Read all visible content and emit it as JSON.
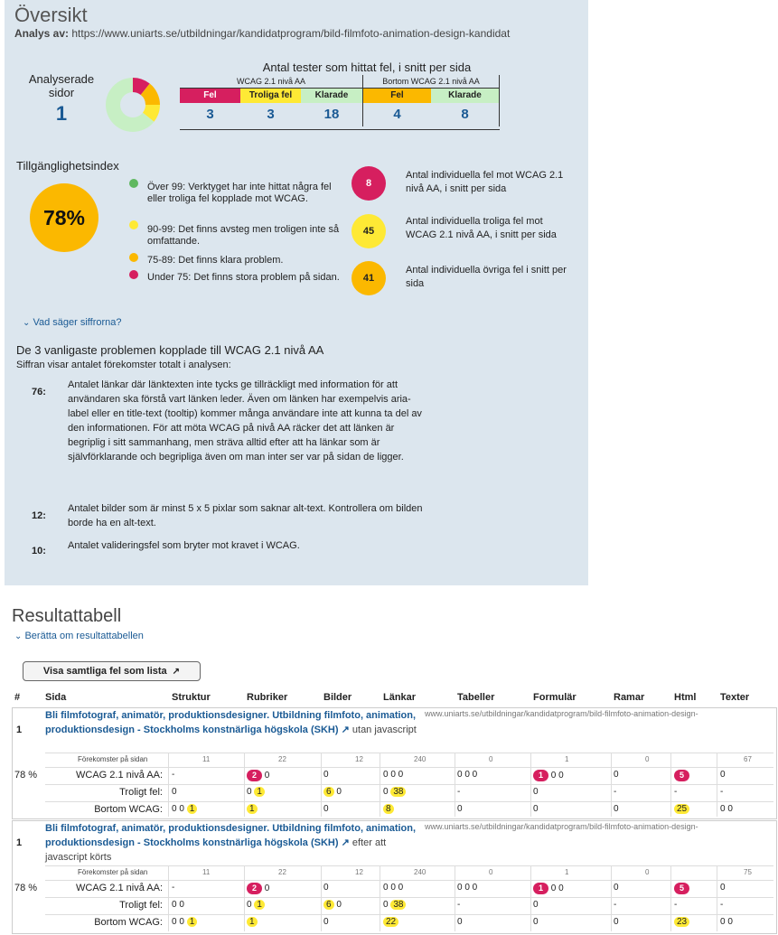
{
  "overview": {
    "title": "Översikt",
    "analys_label": "Analys av:",
    "analys_url": "https://www.uniarts.se/utbildningar/kandidatprogram/bild-filmfoto-animation-design-kandidat",
    "pages_label": "Analyserade sidor",
    "pages_count": "1",
    "tests_title": "Antal tester som hittat fel, i snitt per sida",
    "wcag_group": "WCAG 2.1 nivå AA",
    "beyond_group": "Bortom WCAG 2.1 nivå AA",
    "tests": [
      {
        "label": "Fel",
        "value": "3",
        "color": "#d61f5f",
        "fg": "#fff"
      },
      {
        "label": "Troliga fel",
        "value": "3",
        "color": "#fee935",
        "fg": "#111"
      },
      {
        "label": "Klarade",
        "value": "18",
        "color": "#c7efc4",
        "fg": "#111"
      },
      {
        "label": "Fel",
        "value": "4",
        "color": "#fbb800",
        "fg": "#111"
      },
      {
        "label": "Klarade",
        "value": "8",
        "color": "#c7efc4",
        "fg": "#111"
      }
    ],
    "donut": {
      "passed": 18,
      "error": 3,
      "likely": 3,
      "beyond": 4
    }
  },
  "index": {
    "label": "Tillgänglighetsindex",
    "value": "78%",
    "legend": [
      {
        "text": "Över 99: Verktyget har inte hittat några fel eller troliga fel kopplade mot WCAG.",
        "color": "#5fb85f"
      },
      {
        "text": "90-99: Det finns avsteg men troligen inte så omfattande.",
        "color": "#fee935"
      },
      {
        "text": "75-89: Det finns klara problem.",
        "color": "#fbb800"
      },
      {
        "text": "Under 75: Det finns stora problem på sidan.",
        "color": "#d61f5f"
      }
    ],
    "individual": [
      {
        "value": "8",
        "text": "Antal individuella fel mot WCAG 2.1 nivå AA, i snitt per sida",
        "color": "#d61f5f",
        "fg": "#fff"
      },
      {
        "value": "45",
        "text": "Antal individuella troliga fel mot WCAG 2.1 nivå AA, i snitt per sida",
        "color": "#fee935",
        "fg": "#111"
      },
      {
        "value": "41",
        "text": "Antal individuella övriga fel i snitt per sida",
        "color": "#fbb800",
        "fg": "#111"
      }
    ],
    "explain_link": "Vad säger siffrorna?"
  },
  "common": {
    "title": "De 3 vanligaste problemen kopplade till WCAG 2.1 nivå AA",
    "subtitle": "Siffran visar antalet förekomster totalt i analysen:",
    "items": [
      {
        "count": "76:",
        "text": "Antalet länkar där länktexten inte tycks ge tillräckligt med information för att användaren ska förstå vart länken leder. Även om länken har exempelvis aria-label eller en title-text (tooltip) kommer många användare inte att kunna ta del av den informationen. För att möta WCAG på nivå AA räcker det att länken är begriplig i sitt sammanhang, men sträva alltid efter att ha länkar som är självförklarande och begripliga även om man inter ser var på sidan de ligger."
      },
      {
        "count": "12:",
        "text": "Antalet bilder som är minst 5 x 5 pixlar som saknar alt-text. Kontrollera om bilden borde ha en alt-text."
      },
      {
        "count": "10:",
        "text": "Antalet valideringsfel som bryter mot kravet i WCAG."
      }
    ]
  },
  "results": {
    "title": "Resultattabell",
    "about_link": "Berätta om resultattabellen",
    "show_all_button": "Visa samtliga fel som lista",
    "columns": [
      "#",
      "Sida",
      "Struktur",
      "Rubriker",
      "Bilder",
      "Länkar",
      "Tabeller",
      "Formulär",
      "Ramar",
      "Html",
      "Texter"
    ],
    "occurrence_label": "Förekomster på sidan",
    "row_labels": {
      "wcag": "WCAG 2.1 nivå AA:",
      "likely": "Troligt fel:",
      "beyond": "Bortom WCAG:"
    },
    "rows": [
      {
        "num": "1",
        "title": "Bli filmfotograf, animatör, produktionsdesigner. Utbildning filmfoto, animation, produktionsdesign - Stockholms konstnärliga högskola (SKH)",
        "suffix": "utan javascript",
        "url": "www.uniarts.se/utbildningar/kandidatprogram/bild-filmfoto-animation-design-",
        "score": "78 %",
        "occ": [
          "11",
          "22",
          "12",
          "240",
          "0",
          "1",
          "0",
          "",
          "67"
        ],
        "wcag": [
          "-",
          "2|0",
          "0",
          "0 0 0",
          "0 0 0",
          "1|0 0",
          "0",
          "5",
          "0"
        ],
        "likely": [
          "0",
          "0 1",
          "6 0",
          "0 38",
          "-",
          "0",
          "-",
          "-",
          "-"
        ],
        "beyond": [
          "0 0 1",
          "1",
          "0",
          "8",
          "0",
          "0",
          "0",
          "25",
          "0 0"
        ]
      },
      {
        "num": "1",
        "title": "Bli filmfotograf, animatör, produktionsdesigner. Utbildning filmfoto, animation, produktionsdesign - Stockholms konstnärliga högskola (SKH)",
        "suffix": "efter att javascript körts",
        "url": "www.uniarts.se/utbildningar/kandidatprogram/bild-filmfoto-animation-design-",
        "score": "78 %",
        "occ": [
          "11",
          "22",
          "12",
          "240",
          "0",
          "1",
          "0",
          "",
          "75"
        ],
        "wcag": [
          "-",
          "2|0",
          "0",
          "0 0 0",
          "0 0 0",
          "1|0 0",
          "0",
          "5",
          "0"
        ],
        "likely": [
          "0 0",
          "0 1",
          "6 0",
          "0 38",
          "-",
          "0",
          "-",
          "-",
          "-"
        ],
        "beyond": [
          "0 0 1",
          "1",
          "0",
          "22",
          "0",
          "0",
          "0",
          "23",
          "0 0"
        ]
      }
    ]
  }
}
